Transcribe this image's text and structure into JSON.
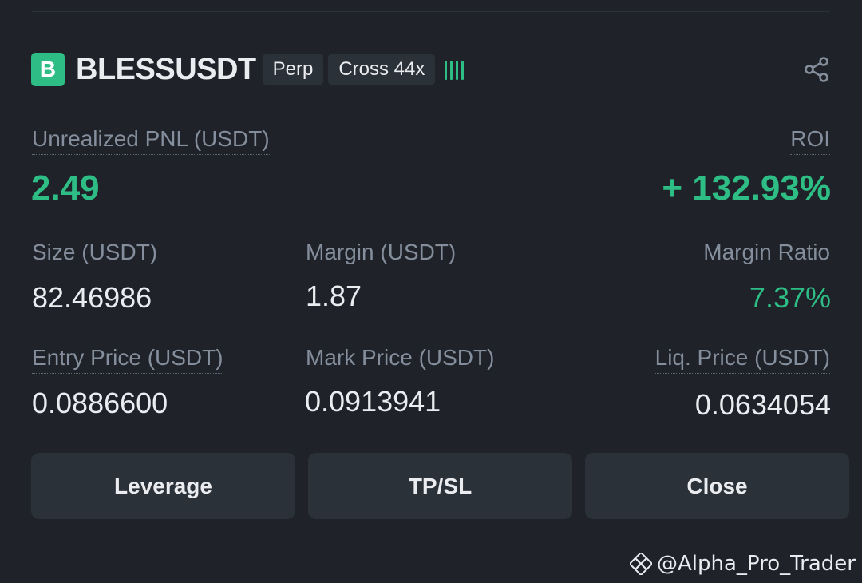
{
  "position": {
    "logo_letter": "B",
    "symbol": "BLESSUSDT",
    "type_tag": "Perp",
    "margin_tag": "Cross 44x",
    "risk_level_bars": 4
  },
  "pnl": {
    "label": "Unrealized PNL (USDT)",
    "value": "2.49"
  },
  "roi": {
    "label": "ROI",
    "value": "+ 132.93%"
  },
  "size": {
    "label": "Size (USDT)",
    "value": "82.46986"
  },
  "margin": {
    "label": "Margin (USDT)",
    "value": "1.87"
  },
  "margin_ratio": {
    "label": "Margin Ratio",
    "value": "7.37%"
  },
  "entry_price": {
    "label": "Entry Price (USDT)",
    "value": "0.0886600"
  },
  "mark_price": {
    "label": "Mark Price (USDT)",
    "value": "0.0913941"
  },
  "liq_price": {
    "label": "Liq. Price (USDT)",
    "value": "0.0634054"
  },
  "buttons": {
    "leverage": "Leverage",
    "tpsl": "TP/SL",
    "close": "Close"
  },
  "watermark": {
    "handle": "@Alpha_Pro_Trader"
  },
  "colors": {
    "background": "#1f2329",
    "positive": "#2ebd85",
    "label": "#848e9c",
    "button": "#2b3139"
  },
  "icons": {
    "share": "share-icon",
    "binance_square": "binance-square-icon"
  }
}
